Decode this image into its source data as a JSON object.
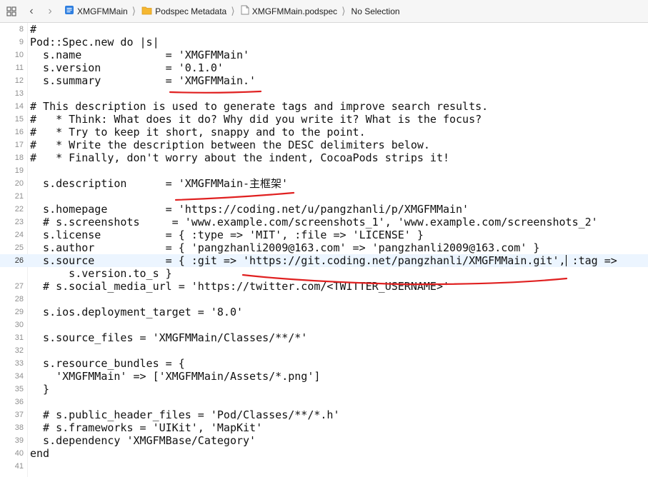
{
  "jumpbar": {
    "crumbs": [
      {
        "label": "XMGFMMain",
        "icon": "project-icon"
      },
      {
        "label": "Podspec Metadata",
        "icon": "folder-icon"
      },
      {
        "label": "XMGFMMain.podspec",
        "icon": "file-icon"
      },
      {
        "label": "No Selection",
        "icon": ""
      }
    ]
  },
  "editor": {
    "current_line": "26",
    "lines": [
      {
        "n": "8",
        "text": "#"
      },
      {
        "n": "9",
        "text": "Pod::Spec.new do |s|"
      },
      {
        "n": "10",
        "text": "  s.name             = 'XMGFMMain'"
      },
      {
        "n": "11",
        "text": "  s.version          = '0.1.0'"
      },
      {
        "n": "12",
        "text": "  s.summary          = 'XMGFMMain.'"
      },
      {
        "n": "13",
        "text": ""
      },
      {
        "n": "14",
        "text": "# This description is used to generate tags and improve search results."
      },
      {
        "n": "15",
        "text": "#   * Think: What does it do? Why did you write it? What is the focus?"
      },
      {
        "n": "16",
        "text": "#   * Try to keep it short, snappy and to the point."
      },
      {
        "n": "17",
        "text": "#   * Write the description between the DESC delimiters below."
      },
      {
        "n": "18",
        "text": "#   * Finally, don't worry about the indent, CocoaPods strips it!"
      },
      {
        "n": "19",
        "text": ""
      },
      {
        "n": "20",
        "text": "  s.description      = 'XMGFMMain-主框架'"
      },
      {
        "n": "21",
        "text": ""
      },
      {
        "n": "22",
        "text": "  s.homepage         = 'https://coding.net/u/pangzhanli/p/XMGFMMain'"
      },
      {
        "n": "23",
        "text": "  # s.screenshots     = 'www.example.com/screenshots_1', 'www.example.com/screenshots_2'"
      },
      {
        "n": "24",
        "text": "  s.license          = { :type => 'MIT', :file => 'LICENSE' }"
      },
      {
        "n": "25",
        "text": "  s.author           = { 'pangzhanli2009@163.com' => 'pangzhanli2009@163.com' }"
      },
      {
        "n": "26",
        "text": "  s.source           = { :git => 'https://git.coding.net/pangzhanli/XMGFMMain.git', :tag =>"
      },
      {
        "n": "",
        "text": "      s.version.to_s }"
      },
      {
        "n": "27",
        "text": "  # s.social_media_url = 'https://twitter.com/<TWITTER_USERNAME>'"
      },
      {
        "n": "28",
        "text": ""
      },
      {
        "n": "29",
        "text": "  s.ios.deployment_target = '8.0'"
      },
      {
        "n": "30",
        "text": ""
      },
      {
        "n": "31",
        "text": "  s.source_files = 'XMGFMMain/Classes/**/*'"
      },
      {
        "n": "32",
        "text": ""
      },
      {
        "n": "33",
        "text": "  s.resource_bundles = {"
      },
      {
        "n": "34",
        "text": "    'XMGFMMain' => ['XMGFMMain/Assets/*.png']"
      },
      {
        "n": "35",
        "text": "  }"
      },
      {
        "n": "36",
        "text": ""
      },
      {
        "n": "37",
        "text": "  # s.public_header_files = 'Pod/Classes/**/*.h'"
      },
      {
        "n": "38",
        "text": "  # s.frameworks = 'UIKit', 'MapKit'"
      },
      {
        "n": "39",
        "text": "  s.dependency 'XMGFMBase/Category'"
      },
      {
        "n": "40",
        "text": "end"
      },
      {
        "n": "41",
        "text": ""
      }
    ]
  },
  "colors": {
    "annotation": "#e02020",
    "current_line_bg": "#ecf5ff",
    "folder": "#f5b731"
  }
}
